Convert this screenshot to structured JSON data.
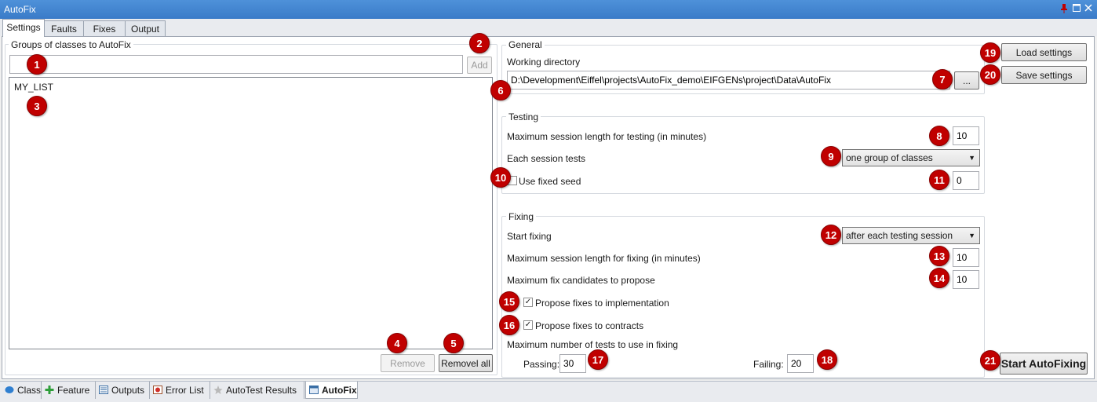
{
  "window": {
    "title": "AutoFix",
    "controls": [
      "pin-icon",
      "maximize-icon",
      "close-icon"
    ]
  },
  "tabs": [
    {
      "label": "Settings",
      "active": true
    },
    {
      "label": "Faults",
      "active": false
    },
    {
      "label": "Fixes",
      "active": false
    },
    {
      "label": "Output",
      "active": false
    }
  ],
  "groups": {
    "legend": "Groups of classes to AutoFix",
    "input_value": "",
    "add_label": "Add",
    "list_items": [
      "MY_LIST"
    ],
    "remove_label": "Remove",
    "remove_all_label": "Removel all"
  },
  "general": {
    "legend": "General",
    "working_dir_label": "Working directory",
    "working_dir_value": "D:\\Development\\Eiffel\\projects\\AutoFix_demo\\EIFGENs\\project\\Data\\AutoFix",
    "browse_label": "..."
  },
  "settings_buttons": {
    "load": "Load settings",
    "save": "Save settings"
  },
  "testing": {
    "legend": "Testing",
    "max_session_label": "Maximum session length for testing (in minutes)",
    "max_session_value": "10",
    "each_session_label": "Each session tests",
    "each_session_value": "one group of classes",
    "fixed_seed_label": "Use fixed seed",
    "fixed_seed_checked": false,
    "seed_value": "0"
  },
  "fixing": {
    "legend": "Fixing",
    "start_fixing_label": "Start fixing",
    "start_fixing_value": "after each testing session",
    "max_session_label": "Maximum session length for fixing (in minutes)",
    "max_session_value": "10",
    "max_candidates_label": "Maximum fix candidates to propose",
    "max_candidates_value": "10",
    "propose_impl_label": "Propose fixes to implementation",
    "propose_impl_checked": true,
    "propose_contracts_label": "Propose fixes to contracts",
    "propose_contracts_checked": true,
    "max_tests_label": "Maximum number of tests to use in fixing",
    "passing_label": "Passing:",
    "passing_value": "30",
    "failing_label": "Failing:",
    "failing_value": "20"
  },
  "start_button": "Start AutoFixing",
  "callouts": [
    "1",
    "2",
    "3",
    "4",
    "5",
    "6",
    "7",
    "8",
    "9",
    "10",
    "11",
    "12",
    "13",
    "14",
    "15",
    "16",
    "17",
    "18",
    "19",
    "20",
    "21"
  ],
  "bottom_tabs": [
    {
      "label": "Class",
      "icon": "class-icon"
    },
    {
      "label": "Feature",
      "icon": "feature-icon"
    },
    {
      "label": "Outputs",
      "icon": "outputs-icon"
    },
    {
      "label": "Error List",
      "icon": "error-list-icon"
    },
    {
      "label": "AutoTest Results",
      "icon": "autotest-icon"
    },
    {
      "label": "AutoFix",
      "icon": "autofix-icon",
      "active": true
    }
  ],
  "colors": {
    "titlebar": "#3a7bc8",
    "badge": "#c00000",
    "panel": "#ffffff",
    "background": "#f0f0f0"
  }
}
